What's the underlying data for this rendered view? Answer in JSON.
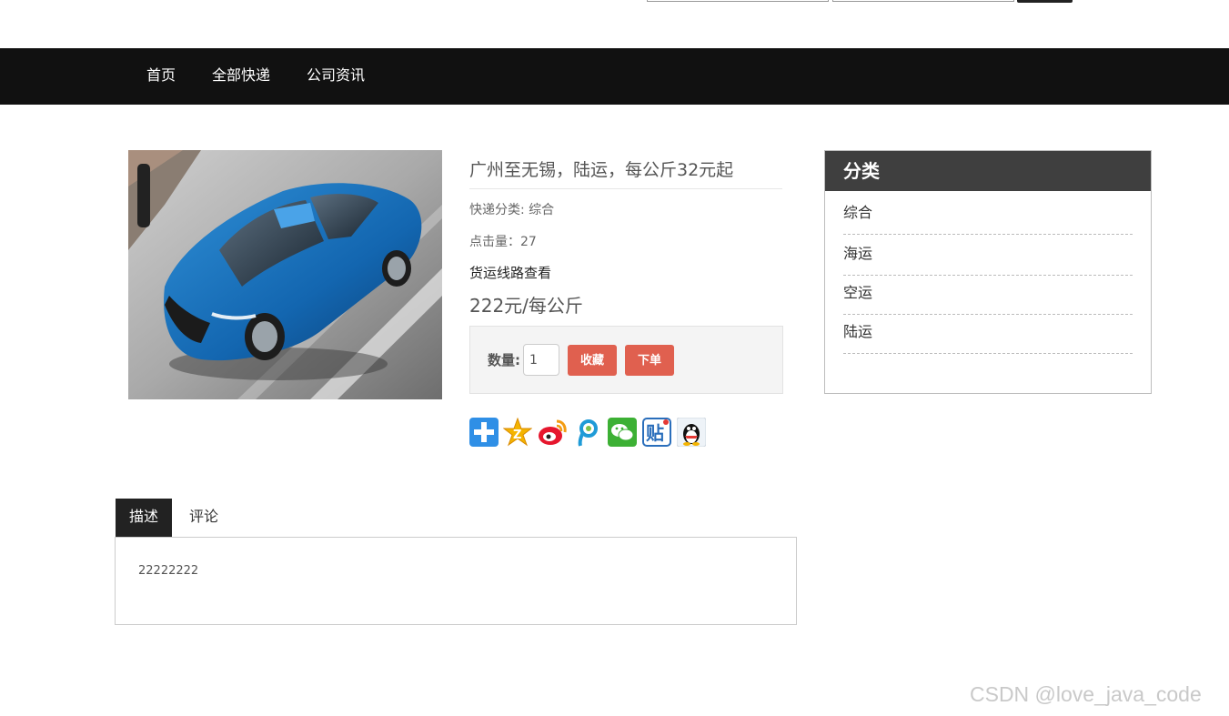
{
  "nav": {
    "items": [
      "首页",
      "全部快递",
      "公司资讯"
    ]
  },
  "product": {
    "image": "car-photo",
    "title": "广州至无锡，陆运，每公斤32元起",
    "category_line": "快递分类: 综合",
    "clicks_line": "点击量：27",
    "route_link": "货运线路查看",
    "price": "222元/每公斤",
    "quantity_label": "数量:",
    "quantity_value": "1",
    "favorite_label": "收藏",
    "order_label": "下单"
  },
  "share": {
    "icons": [
      "plus-share-icon",
      "qzone-icon",
      "weibo-icon",
      "tencent-weibo-icon",
      "wechat-icon",
      "tieba-icon",
      "qq-icon"
    ]
  },
  "sidebar": {
    "title": "分类",
    "items": [
      "综合",
      "海运",
      "空运",
      "陆运"
    ]
  },
  "tabs": {
    "items": [
      "描述",
      "评论"
    ],
    "active": "描述",
    "description": "22222222"
  },
  "watermark": "CSDN @love_java_code",
  "colors": {
    "navbar": "#111111",
    "button_red": "#e0604f",
    "sidebar_header": "#3f3f3f",
    "tab_active": "#222222"
  }
}
